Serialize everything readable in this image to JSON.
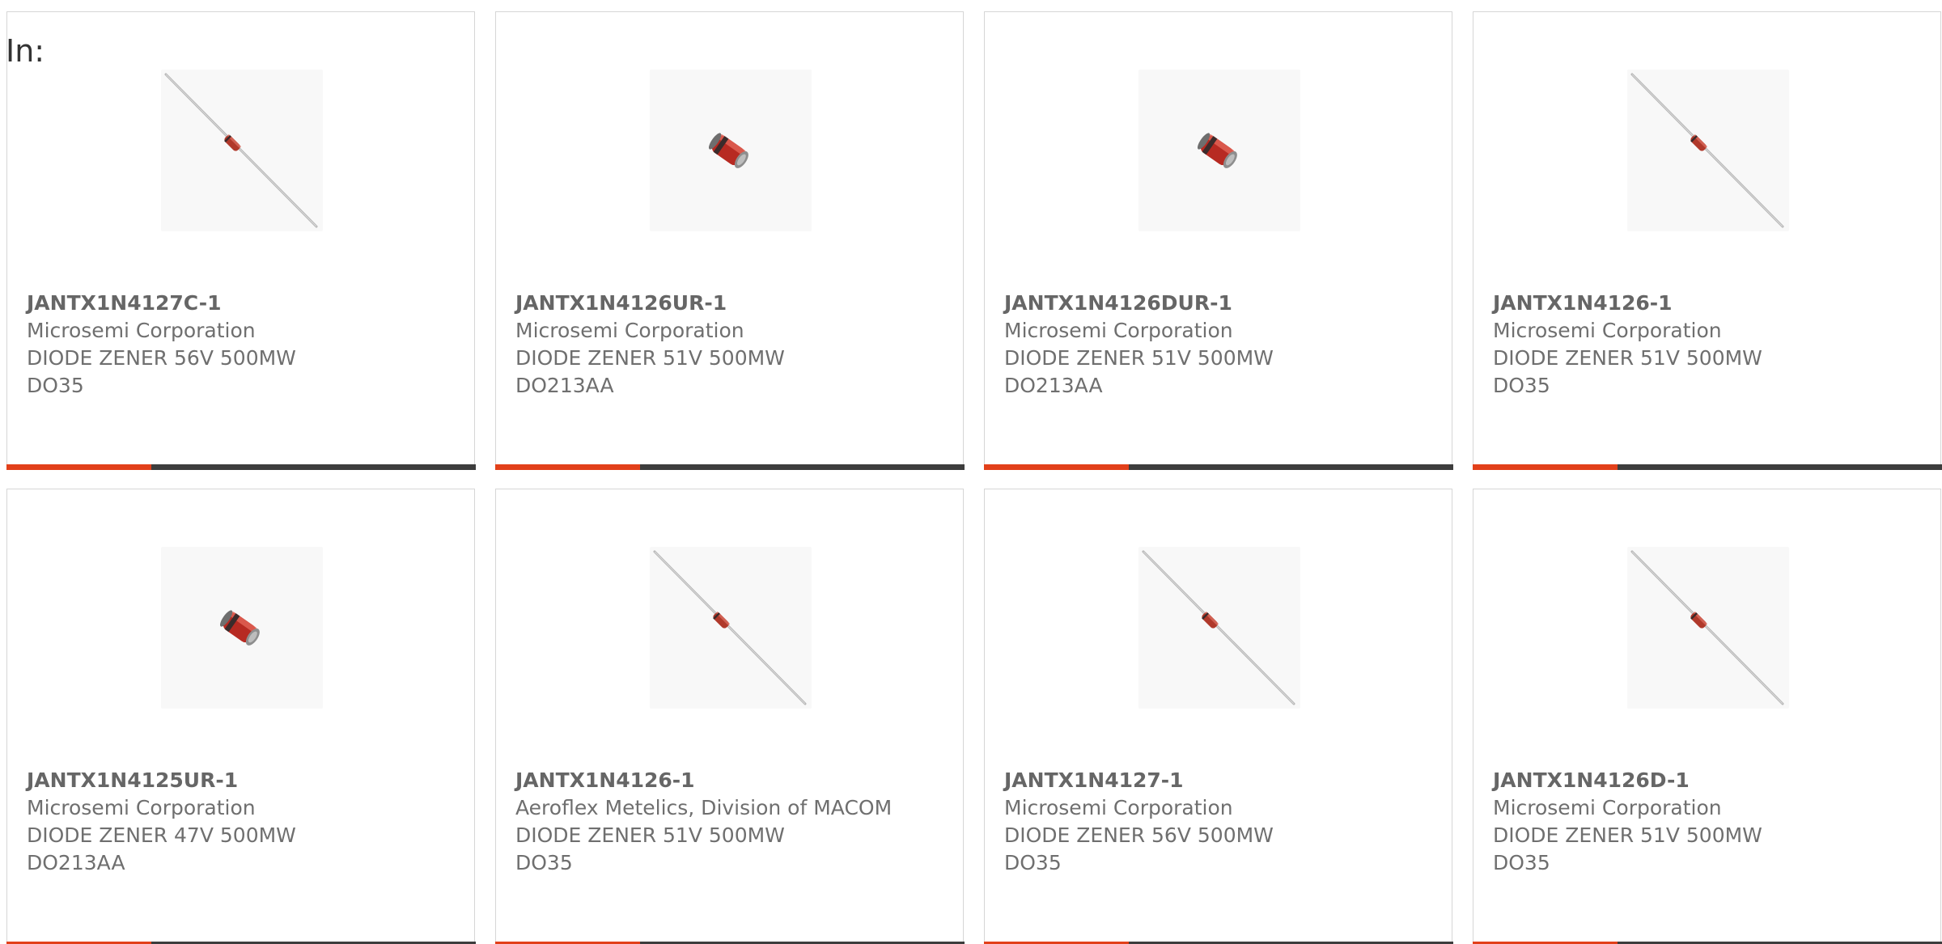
{
  "header": {
    "in_label": "In:"
  },
  "colors": {
    "accent": "#e2401a",
    "bar_dark": "#3d3d3d",
    "border": "#d6d6d6",
    "text": "#6f6f6f"
  },
  "products": [
    {
      "part_number": "JANTX1N4127C-1",
      "manufacturer": "Microsemi Corporation",
      "description": "DIODE ZENER 56V 500MW DO35",
      "image_icon": "axial-diode-icon",
      "progress": 0.31
    },
    {
      "part_number": "JANTX1N4126UR-1",
      "manufacturer": "Microsemi Corporation",
      "description": "DIODE ZENER 51V 500MW DO213AA",
      "image_icon": "melf-diode-icon",
      "progress": 0.31
    },
    {
      "part_number": "JANTX1N4126DUR-1",
      "manufacturer": "Microsemi Corporation",
      "description": "DIODE ZENER 51V 500MW DO213AA",
      "image_icon": "melf-diode-icon",
      "progress": 0.31
    },
    {
      "part_number": "JANTX1N4126-1",
      "manufacturer": "Microsemi Corporation",
      "description": "DIODE ZENER 51V 500MW DO35",
      "image_icon": "axial-diode-icon",
      "progress": 0.31
    },
    {
      "part_number": "JANTX1N4125UR-1",
      "manufacturer": "Microsemi Corporation",
      "description": "DIODE ZENER 47V 500MW DO213AA",
      "image_icon": "melf-diode-icon",
      "progress": 0.31
    },
    {
      "part_number": "JANTX1N4126-1",
      "manufacturer": "Aeroflex Metelics, Division of MACOM",
      "description": "DIODE ZENER 51V 500MW DO35",
      "image_icon": "axial-diode-icon",
      "progress": 0.31
    },
    {
      "part_number": "JANTX1N4127-1",
      "manufacturer": "Microsemi Corporation",
      "description": "DIODE ZENER 56V 500MW DO35",
      "image_icon": "axial-diode-icon",
      "progress": 0.31
    },
    {
      "part_number": "JANTX1N4126D-1",
      "manufacturer": "Microsemi Corporation",
      "description": "DIODE ZENER 51V 500MW DO35",
      "image_icon": "axial-diode-icon",
      "progress": 0.31
    }
  ]
}
